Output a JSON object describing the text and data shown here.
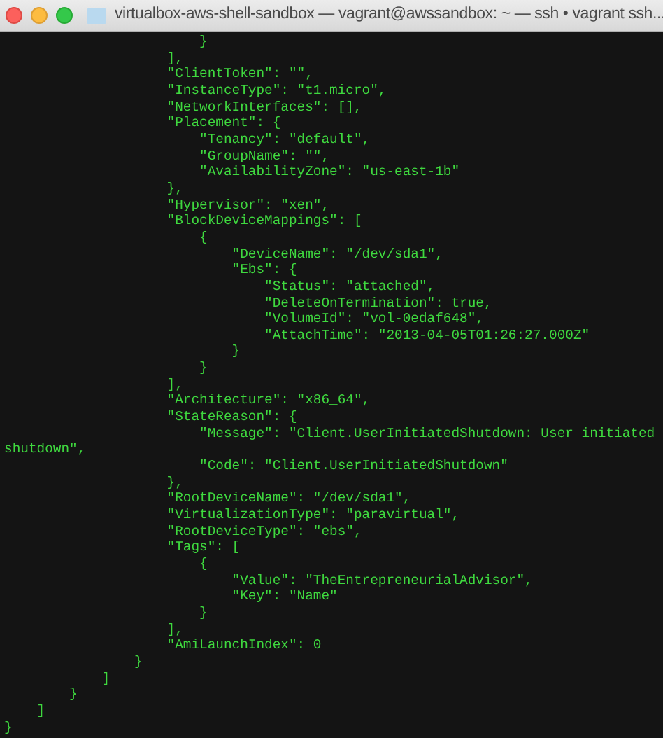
{
  "window": {
    "title": "virtualbox-aws-shell-sandbox — vagrant@awssandbox: ~ — ssh • vagrant ssh..."
  },
  "terminal": {
    "lines": [
      "                        }",
      "                    ],",
      "                    \"ClientToken\": \"\",",
      "                    \"InstanceType\": \"t1.micro\",",
      "                    \"NetworkInterfaces\": [],",
      "                    \"Placement\": {",
      "                        \"Tenancy\": \"default\",",
      "                        \"GroupName\": \"\",",
      "                        \"AvailabilityZone\": \"us-east-1b\"",
      "                    },",
      "                    \"Hypervisor\": \"xen\",",
      "                    \"BlockDeviceMappings\": [",
      "                        {",
      "                            \"DeviceName\": \"/dev/sda1\",",
      "                            \"Ebs\": {",
      "                                \"Status\": \"attached\",",
      "                                \"DeleteOnTermination\": true,",
      "                                \"VolumeId\": \"vol-0edaf648\",",
      "                                \"AttachTime\": \"2013-04-05T01:26:27.000Z\"",
      "                            }",
      "                        }",
      "                    ],",
      "                    \"Architecture\": \"x86_64\",",
      "                    \"StateReason\": {",
      "                        \"Message\": \"Client.UserInitiatedShutdown: User initiated",
      "shutdown\",",
      "                        \"Code\": \"Client.UserInitiatedShutdown\"",
      "                    },",
      "                    \"RootDeviceName\": \"/dev/sda1\",",
      "                    \"VirtualizationType\": \"paravirtual\",",
      "                    \"RootDeviceType\": \"ebs\",",
      "                    \"Tags\": [",
      "                        {",
      "                            \"Value\": \"TheEntrepreneurialAdvisor\",",
      "                            \"Key\": \"Name\"",
      "                        }",
      "                    ],",
      "                    \"AmiLaunchIndex\": 0",
      "                }",
      "            ]",
      "        }",
      "    ]",
      "}"
    ]
  }
}
